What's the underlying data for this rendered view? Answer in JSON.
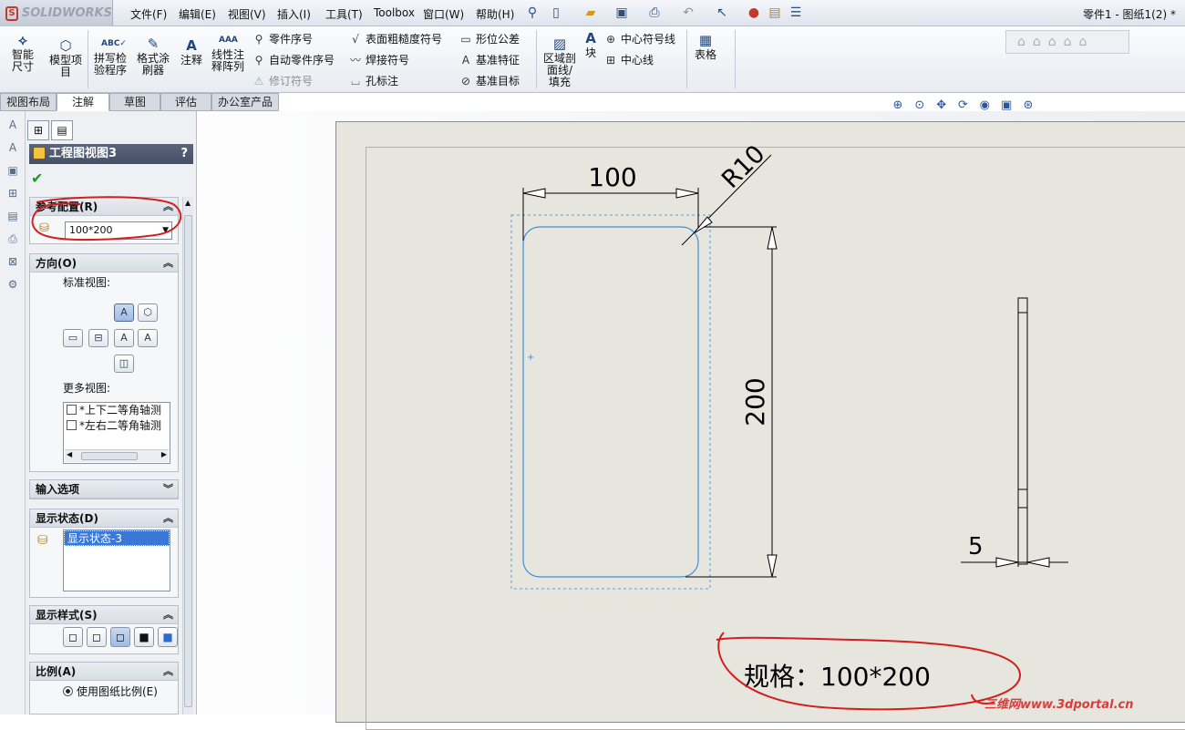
{
  "app": {
    "logo": "SOLIDWORKS",
    "title": "零件1 - 图纸1(2) *"
  },
  "menu": [
    "文件(F)",
    "编辑(E)",
    "视图(V)",
    "插入(I)",
    "工具(T)",
    "Toolbox",
    "窗口(W)",
    "帮助(H)"
  ],
  "ribbon": {
    "smart_dim": "智能尺寸",
    "model_items": "模型项目",
    "spell": "拼写检验程序",
    "format_painter": "格式涂刷器",
    "note": "注释",
    "linear_note": "线性注释阵列",
    "balloon": "零件序号",
    "auto_balloon": "自动零件序号",
    "revision": "修订符号",
    "surface": "表面粗糙度符号",
    "weld": "焊接符号",
    "hole": "孔标注",
    "gtol": "形位公差",
    "datum_feature": "基准特征",
    "datum_target": "基准目标",
    "hatch": "区域剖面线/填充",
    "block": "块",
    "center_mark": "中心符号线",
    "centerline": "中心线",
    "table": "表格"
  },
  "tabs": [
    "视图布局",
    "注解",
    "草图",
    "评估",
    "办公室产品"
  ],
  "panel": {
    "title": "工程图视图3",
    "help": "?",
    "ref_config": {
      "header": "参考配置(R)",
      "value": "100*200"
    },
    "orientation": {
      "header": "方向(O)",
      "std_label": "标准视图:",
      "more_label": "更多视图:",
      "more_views": [
        "*上下二等角轴测",
        "*左右二等角轴测"
      ]
    },
    "import": {
      "header": "输入选项"
    },
    "display_state": {
      "header": "显示状态(D)",
      "item": "显示状态-3"
    },
    "display_style": {
      "header": "显示样式(S)"
    },
    "scale": {
      "header": "比例(A)",
      "option": "使用图纸比例(E)"
    }
  },
  "drawing": {
    "dim_width": "100",
    "dim_radius": "R10",
    "dim_height": "200",
    "dim_thickness": "5",
    "spec_note": "规格：100*200"
  },
  "watermark": "三维网www.3dportal.cn",
  "colors": {
    "geometry": "#3f8fd6",
    "annotation_circle": "#d31f1f",
    "sheet": "#e7e6de"
  }
}
